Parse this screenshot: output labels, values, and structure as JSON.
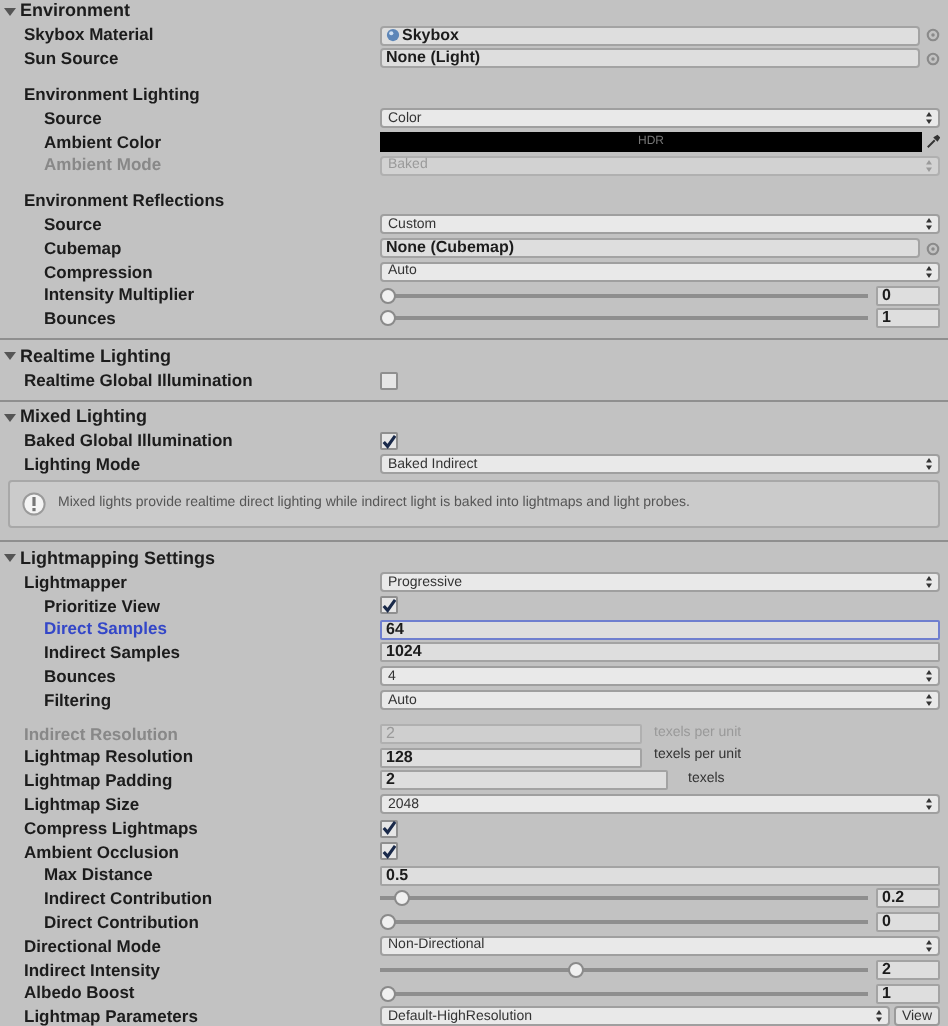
{
  "sections": [
    {
      "title": "Environment",
      "expanded": true,
      "rows": [
        {
          "kind": "object",
          "label": "Skybox Material",
          "value": "Skybox",
          "asset_icon": true
        },
        {
          "kind": "object",
          "label": "Sun Source",
          "value": "None (Light)"
        },
        {
          "kind": "heading",
          "label": "Environment Lighting",
          "children": [
            {
              "kind": "dropdown",
              "label": "Source",
              "value": "Color"
            },
            {
              "kind": "color",
              "label": "Ambient Color",
              "color": "#000000",
              "badge": "HDR"
            },
            {
              "kind": "dropdown",
              "label": "Ambient Mode",
              "value": "Baked",
              "disabled": true
            }
          ]
        },
        {
          "kind": "heading",
          "label": "Environment Reflections",
          "children": [
            {
              "kind": "dropdown",
              "label": "Source",
              "value": "Custom"
            },
            {
              "kind": "object",
              "label": "Cubemap",
              "value": "None (Cubemap)"
            },
            {
              "kind": "dropdown",
              "label": "Compression",
              "value": "Auto"
            },
            {
              "kind": "slider",
              "label": "Intensity Multiplier",
              "level": 0,
              "value": "0"
            },
            {
              "kind": "slider",
              "label": "Bounces",
              "level": 0,
              "value": "1"
            }
          ]
        }
      ]
    },
    {
      "title": "Realtime Lighting",
      "expanded": true,
      "rows": [
        {
          "kind": "checkbox",
          "label": "Realtime Global Illumination",
          "checked": false
        }
      ]
    },
    {
      "title": "Mixed Lighting",
      "expanded": true,
      "rows": [
        {
          "kind": "checkbox",
          "label": "Baked Global Illumination",
          "checked": true
        },
        {
          "kind": "dropdown",
          "label": "Lighting Mode",
          "value": "Baked Indirect"
        },
        {
          "kind": "helpbox",
          "text": "Mixed lights provide realtime direct lighting while indirect light is baked into lightmaps and light probes."
        }
      ]
    },
    {
      "title": "Lightmapping Settings",
      "expanded": true,
      "rows": [
        {
          "kind": "dropdown",
          "label": "Lightmapper",
          "value": "Progressive",
          "children": [
            {
              "kind": "checkbox",
              "label": "Prioritize View",
              "checked": true
            },
            {
              "kind": "number",
              "label": "Direct Samples",
              "value": "64",
              "focused": true
            },
            {
              "kind": "number",
              "label": "Indirect Samples",
              "value": "1024"
            },
            {
              "kind": "dropdown",
              "label": "Bounces",
              "value": "4"
            },
            {
              "kind": "dropdown",
              "label": "Filtering",
              "value": "Auto"
            }
          ]
        },
        {
          "kind": "number",
          "label": "Indirect Resolution",
          "value": "2",
          "suffix": "texels per unit",
          "disabled": true
        },
        {
          "kind": "number",
          "label": "Lightmap Resolution",
          "value": "128",
          "suffix": "texels per unit"
        },
        {
          "kind": "number",
          "label": "Lightmap Padding",
          "value": "2",
          "suffix": "texels"
        },
        {
          "kind": "dropdown",
          "label": "Lightmap Size",
          "value": "2048"
        },
        {
          "kind": "checkbox",
          "label": "Compress Lightmaps",
          "checked": true
        },
        {
          "kind": "checkbox",
          "label": "Ambient Occlusion",
          "checked": true,
          "children": [
            {
              "kind": "number",
              "label": "Max Distance",
              "value": "0.5"
            },
            {
              "kind": "slider",
              "label": "Indirect Contribution",
              "level": 0.03,
              "value": "0.2"
            },
            {
              "kind": "slider",
              "label": "Direct Contribution",
              "level": 0,
              "value": "0"
            }
          ]
        },
        {
          "kind": "dropdown",
          "label": "Directional Mode",
          "value": "Non-Directional"
        },
        {
          "kind": "slider",
          "label": "Indirect Intensity",
          "level": 0.4,
          "value": "2"
        },
        {
          "kind": "slider",
          "label": "Albedo Boost",
          "level": 0,
          "value": "1"
        },
        {
          "kind": "dropdown",
          "label": "Lightmap Parameters",
          "value": "Default-HighResolution",
          "button": "View"
        }
      ]
    }
  ]
}
